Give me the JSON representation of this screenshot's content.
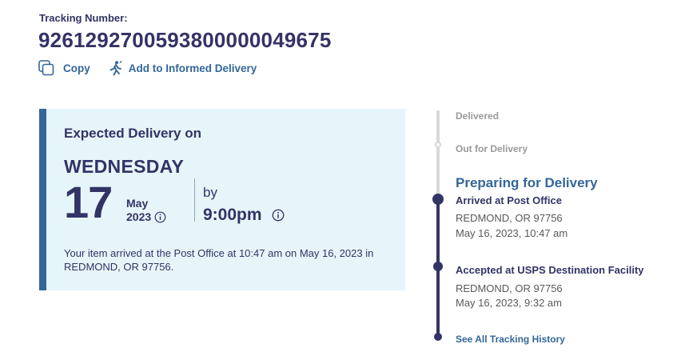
{
  "tracking": {
    "label": "Tracking Number:",
    "number": "9261292700593800000049675"
  },
  "actions": {
    "copy_label": "Copy",
    "copy_icon": "copy-icon",
    "informed_label": "Add to Informed Delivery",
    "informed_icon": "runner-icon"
  },
  "delivery": {
    "title": "Expected Delivery on",
    "day_name": "WEDNESDAY",
    "day": "17",
    "month": "May",
    "year": "2023",
    "by": "by",
    "time": "9:00pm",
    "description": "Your item arrived at the Post Office at 10:47 am on May 16, 2023 in REDMOND, OR 97756."
  },
  "timeline": {
    "delivered": "Delivered",
    "out_for_delivery": "Out for Delivery",
    "current_status": "Preparing for Delivery",
    "events": [
      {
        "title": "Arrived at Post Office",
        "location": "REDMOND, OR 97756",
        "datetime": "May 16, 2023, 10:47 am"
      },
      {
        "title": "Accepted at USPS Destination Facility",
        "location": "REDMOND, OR 97756",
        "datetime": "May 16, 2023, 9:32 am"
      }
    ],
    "history_link": "See All Tracking History"
  },
  "colors": {
    "navy": "#333366",
    "link_blue": "#336699",
    "card_bg": "#e6f5f9",
    "muted_grey": "#999999",
    "timeline_grey": "#d9d9d9"
  }
}
